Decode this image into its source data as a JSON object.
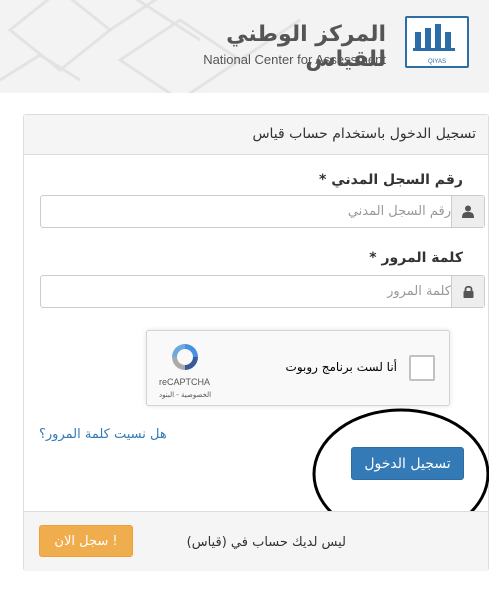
{
  "header": {
    "brand_ar": "المركز الوطني للقياس",
    "brand_en": "National Center for Assessment",
    "logo_text": "QIYAS"
  },
  "panel": {
    "title": "تسجيل الدخول باستخدام حساب قياس"
  },
  "form": {
    "id_label": "رقم السجل المدني *",
    "id_placeholder": "رقم السجل المدني",
    "id_value": "",
    "password_label": "كلمة المرور *",
    "password_placeholder": "كلمة المرور",
    "password_value": "",
    "user_icon": "user-icon",
    "lock_icon": "lock-icon"
  },
  "recaptcha": {
    "checkbox_label": "أنا لست برنامج روبوت",
    "brand": "reCAPTCHA",
    "terms": "الخصوصية - البنود"
  },
  "actions": {
    "forgot_password": "هل نسيت كلمة المرور؟",
    "login": "تسجيل الدخول"
  },
  "footer": {
    "no_account": "ليس لديك حساب في (قياس)",
    "register": "سجل الان !"
  },
  "colors": {
    "primary": "#337ab7",
    "warning": "#f0ad4e",
    "panel_bg": "#f5f5f5"
  }
}
